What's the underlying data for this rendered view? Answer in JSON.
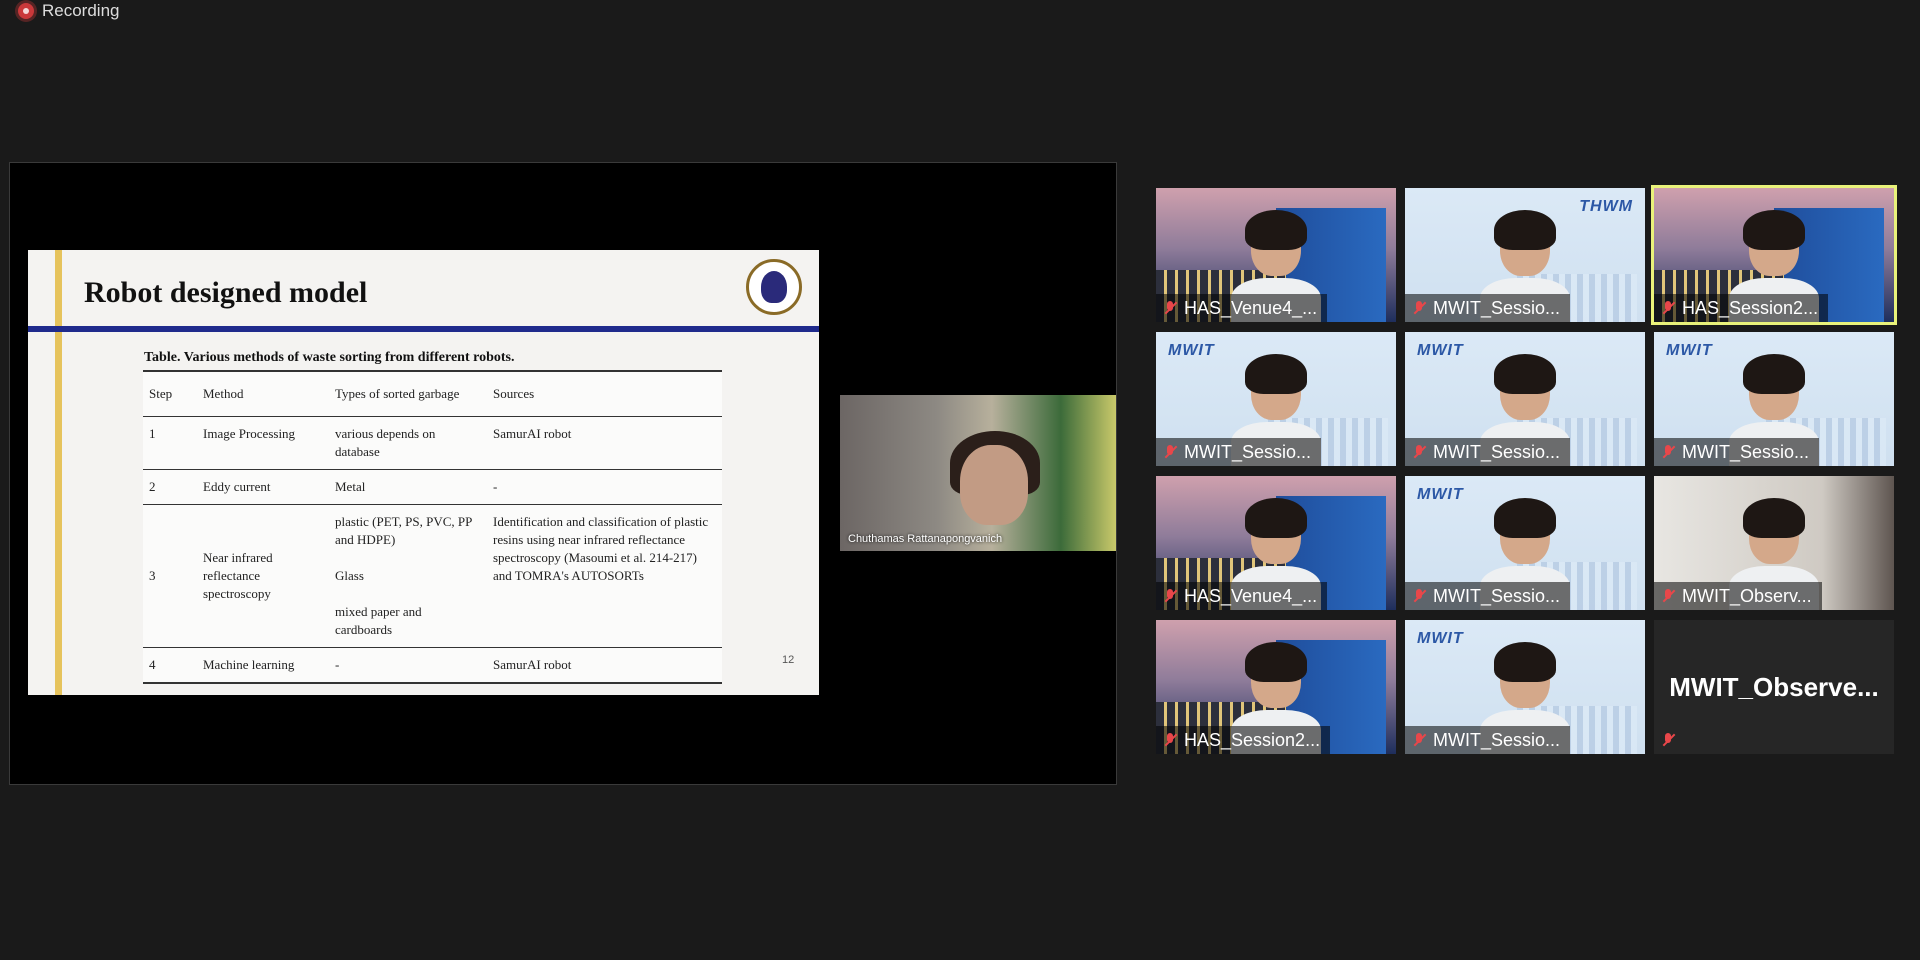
{
  "recording": {
    "label": "Recording"
  },
  "slide": {
    "title": "Robot designed model",
    "table_caption": "Table. Various methods of waste sorting from different robots.",
    "headers": [
      "Step",
      "Method",
      "Types of sorted garbage",
      "Sources"
    ],
    "rows": [
      [
        "1",
        "Image Processing",
        "various depends on database",
        "SamurAI robot"
      ],
      [
        "2",
        "Eddy current",
        "Metal",
        "-"
      ],
      [
        "3",
        "Near infrared reflectance spectroscopy",
        "plastic (PET, PS, PVC, PP and HDPE)\n\nGlass\n\nmixed paper and cardboards",
        "Identification and classification of plastic resins using near infrared reflectance spectroscopy (Masoumi et al. 214-217) and TOMRA's AUTOSORTs"
      ],
      [
        "4",
        "Machine learning",
        "-",
        "SamurAI robot"
      ]
    ],
    "page_number": "12"
  },
  "presenter": {
    "name": "Chuthamas Rattanapongvanich"
  },
  "participants": [
    {
      "name": "HAS_Venue4_...",
      "bg": "campus"
    },
    {
      "name": "MWIT_Sessio...",
      "bg": "mwit-thwm"
    },
    {
      "name": "HAS_Session2...",
      "bg": "campus",
      "active": true
    },
    {
      "name": "MWIT_Sessio...",
      "bg": "mwit"
    },
    {
      "name": "MWIT_Sessio...",
      "bg": "mwit"
    },
    {
      "name": "MWIT_Sessio...",
      "bg": "mwit"
    },
    {
      "name": "HAS_Venue4_...",
      "bg": "campus"
    },
    {
      "name": "MWIT_Sessio...",
      "bg": "mwit"
    },
    {
      "name": "MWIT_Observ...",
      "bg": "room"
    },
    {
      "name": "HAS_Session2...",
      "bg": "campus"
    },
    {
      "name": "MWIT_Sessio...",
      "bg": "mwit"
    },
    {
      "name": "",
      "big_name": "MWIT_Observe...",
      "bg": "black"
    }
  ],
  "logos": {
    "mwit": "MWIT",
    "thwm": "THWM"
  },
  "colors": {
    "active_outline": "#e9f27a",
    "muted_mic": "#e8474a",
    "slide_rule": "#1f2a8c"
  }
}
